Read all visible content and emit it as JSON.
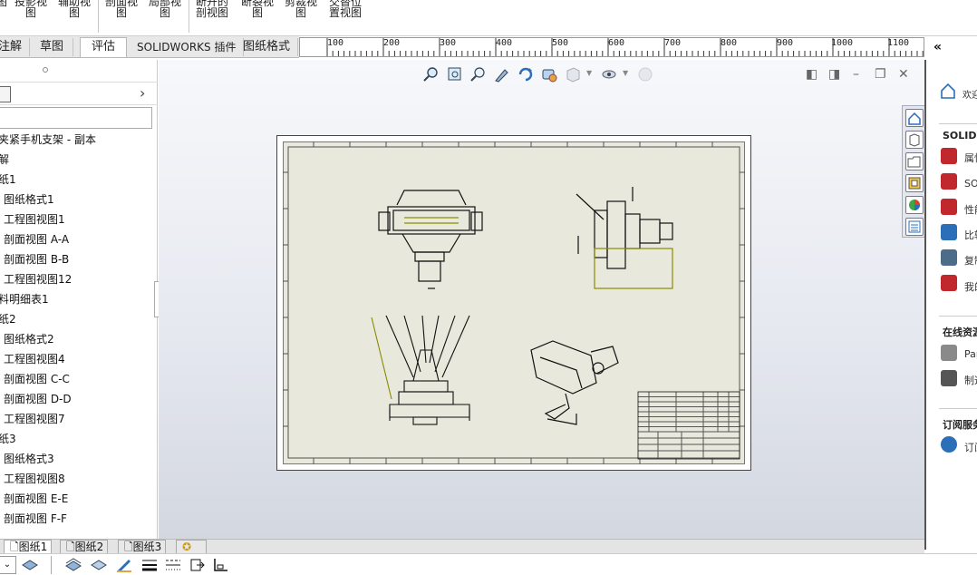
{
  "ribbon": {
    "items": [
      {
        "line1": "图",
        "line2": ""
      },
      {
        "line1": "投影视",
        "line2": "图"
      },
      {
        "line1": "辅助视",
        "line2": "图"
      },
      {
        "line1": "剖面视",
        "line2": "图"
      },
      {
        "line1": "局部视",
        "line2": "图"
      },
      {
        "line1": "断开的",
        "line2": "剖视图"
      },
      {
        "line1": "断裂视",
        "line2": "图"
      },
      {
        "line1": "剪裁视",
        "line2": "图"
      },
      {
        "line1": "交替位",
        "line2": "置视图"
      }
    ]
  },
  "tabs": [
    "注解",
    "草图",
    "评估",
    "SOLIDWORKS 插件",
    "图纸格式"
  ],
  "active_tab": "评估",
  "ruler": {
    "ticks": [
      "100",
      "200",
      "300",
      "400",
      "500",
      "600",
      "700",
      "800",
      "900",
      "1000",
      "1100"
    ]
  },
  "collapse_label": "«",
  "tree": {
    "items": [
      {
        "label": "夹紧手机支架 - 副本",
        "indent": 0
      },
      {
        "label": "解",
        "indent": 0
      },
      {
        "label": "纸1",
        "indent": 0
      },
      {
        "label": "图纸格式1",
        "indent": 1
      },
      {
        "label": "工程图视图1",
        "indent": 1
      },
      {
        "label": "剖面视图 A-A",
        "indent": 1
      },
      {
        "label": "剖面视图 B-B",
        "indent": 1
      },
      {
        "label": "工程图视图12",
        "indent": 1
      },
      {
        "label": "料明细表1",
        "indent": 0
      },
      {
        "label": "纸2",
        "indent": 0
      },
      {
        "label": "图纸格式2",
        "indent": 1
      },
      {
        "label": "工程图视图4",
        "indent": 1
      },
      {
        "label": "剖面视图 C-C",
        "indent": 1
      },
      {
        "label": "剖面视图 D-D",
        "indent": 1
      },
      {
        "label": "工程图视图7",
        "indent": 1
      },
      {
        "label": "纸3",
        "indent": 0
      },
      {
        "label": "图纸格式3",
        "indent": 1
      },
      {
        "label": "工程图视图8",
        "indent": 1
      },
      {
        "label": "剖面视图 E-E",
        "indent": 1
      },
      {
        "label": "剖面视图 F-F",
        "indent": 1
      }
    ]
  },
  "sheet_tabs": [
    "图纸1",
    "图纸2",
    "图纸3"
  ],
  "active_sheet": "图纸1",
  "right_panel": {
    "welcome": "欢迎",
    "section1_title": "SOLIDW",
    "section1_items": [
      "属性",
      "SO",
      "性能",
      "比较",
      "复制",
      "我的"
    ],
    "section2_title": "在线资源",
    "section2_items": [
      "Par",
      "制造"
    ],
    "section3_title": "订阅服务",
    "section3_items": [
      "订阅"
    ]
  },
  "colors": {
    "sheet_bg": "#e8e8dc",
    "accent_red": "#c0282d",
    "accent_blue": "#2a6fb8",
    "line_color": "#111111",
    "dim_color": "#8a8a00"
  }
}
